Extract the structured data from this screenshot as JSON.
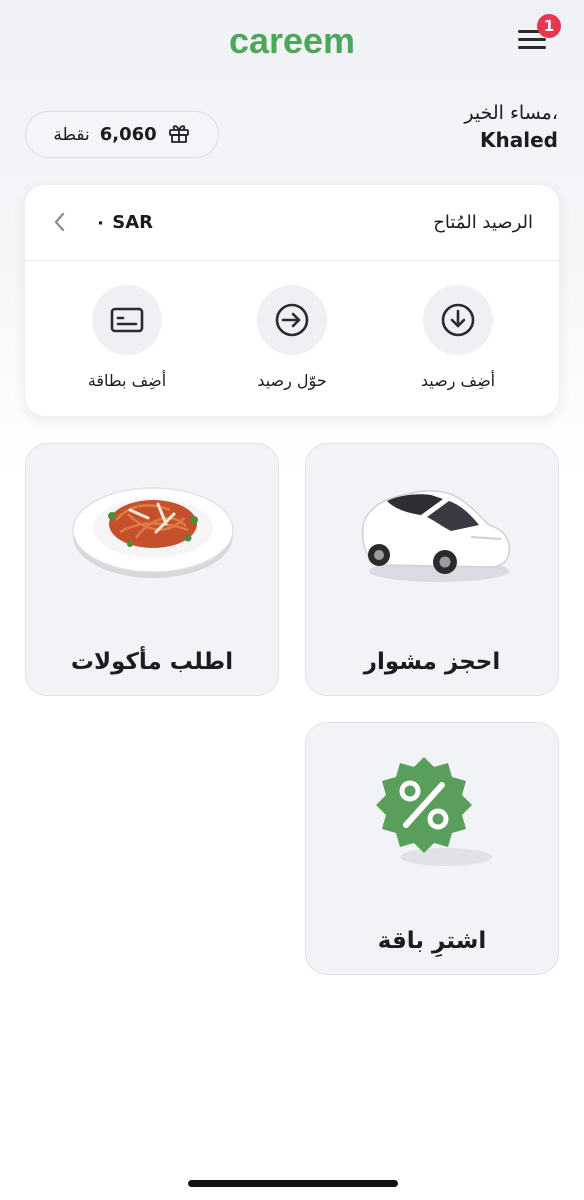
{
  "header": {
    "logo_text": "careem",
    "notification_count": "1"
  },
  "greeting": {
    "line": "مساء الخير،",
    "name": "Khaled"
  },
  "points": {
    "value": "6,060",
    "unit": "نقطة"
  },
  "balance": {
    "title": "الرصيد المُتاح",
    "amount": "٠ SAR",
    "actions": [
      {
        "label": "أضِف رصيد",
        "icon": "download-circle-icon"
      },
      {
        "label": "حوّل رصيد",
        "icon": "arrow-right-circle-icon"
      },
      {
        "label": "أضِف بطاقة",
        "icon": "card-icon"
      }
    ]
  },
  "services": [
    {
      "label": "احجز مشوار",
      "icon": "car-icon"
    },
    {
      "label": "اطلب مأكولات",
      "icon": "food-plate-icon"
    },
    {
      "label": "اشترِ باقة",
      "icon": "percent-badge-icon"
    }
  ],
  "colors": {
    "brand": "#4aa85a",
    "badge": "#e8374f",
    "tile_bg": "#f2f3f7",
    "promo_green": "#5a9e5c"
  }
}
